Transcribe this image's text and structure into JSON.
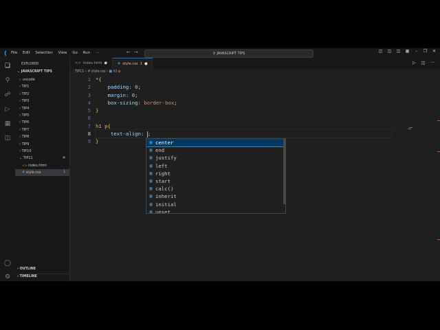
{
  "titlebar": {
    "menu": [
      "File",
      "Edit",
      "Selection",
      "View",
      "Go",
      "Run",
      "···"
    ],
    "search_text": "JAVASCRIPT TIPS"
  },
  "sidebar": {
    "header": "EXPLORER",
    "root": "JAVASCRIPT TIPS",
    "items": [
      {
        "label": ".vscode",
        "kind": "folder"
      },
      {
        "label": "TIP1",
        "kind": "folder"
      },
      {
        "label": "TIP2",
        "kind": "folder"
      },
      {
        "label": "TIP3",
        "kind": "folder"
      },
      {
        "label": "TIP4",
        "kind": "folder"
      },
      {
        "label": "TIP5",
        "kind": "folder"
      },
      {
        "label": "TIP6",
        "kind": "folder"
      },
      {
        "label": "TIP7",
        "kind": "folder"
      },
      {
        "label": "TIP8",
        "kind": "folder"
      },
      {
        "label": "TIP9",
        "kind": "folder"
      },
      {
        "label": "TIP10",
        "kind": "folder"
      },
      {
        "label": "TIP11",
        "kind": "folder-open"
      },
      {
        "label": "index.html",
        "kind": "html"
      },
      {
        "label": "style.css",
        "kind": "css",
        "badge": "1"
      }
    ],
    "outline": "OUTLINE",
    "timeline": "TIMELINE"
  },
  "tabs": [
    {
      "label": "index.html",
      "icon": "<>",
      "active": false
    },
    {
      "label": "style.css",
      "icon": "#",
      "badge": "1",
      "active": true
    }
  ],
  "breadcrumb": {
    "folder": "TIP11",
    "file": "style.css",
    "symbol": "h1 p"
  },
  "editor": {
    "line_numbers": [
      "1",
      "2",
      "3",
      "4",
      "5",
      "6",
      "7",
      "8",
      "9"
    ],
    "current_line": "8"
  },
  "suggestions": [
    "center",
    "end",
    "justify",
    "left",
    "right",
    "start",
    "calc()",
    "inherit",
    "initial",
    "unset"
  ],
  "colors": {
    "accent": "#0078d4",
    "editor_bg": "#1f1f1f",
    "selector": "#d7ba7d",
    "property": "#9cdcfe",
    "number": "#b5cea8"
  }
}
